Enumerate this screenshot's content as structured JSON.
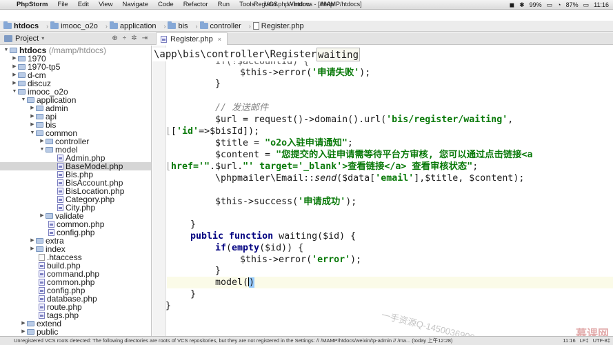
{
  "menubar": {
    "app": "PhpStorm",
    "items": [
      "File",
      "Edit",
      "View",
      "Navigate",
      "Code",
      "Refactor",
      "Run",
      "Tools",
      "VCS",
      "Window",
      "Help"
    ],
    "window_title": "Register.php - htdocs - [/MAMP/htdocs]",
    "tray": {
      "battery_a": "99%",
      "battery_b": "87%",
      "clock": "11:16"
    }
  },
  "breadcrumbs": [
    "htdocs",
    "imooc_o2o",
    "application",
    "bis",
    "controller",
    "Register.php"
  ],
  "project_panel": {
    "title": "Project",
    "root_label": "htdocs",
    "root_path": "(/mamp/htdocs)",
    "items": [
      "1970",
      "1970-tp5",
      "d-cm",
      "discuz",
      "imooc_o2o",
      "application",
      "admin",
      "api",
      "bis",
      "common",
      "controller",
      "model",
      "Admin.php",
      "BaseModel.php",
      "Bis.php",
      "BisAccount.php",
      "BisLocation.php",
      "Category.php",
      "City.php",
      "validate",
      "common.php",
      "config.php",
      "extra",
      "index",
      ".htaccess",
      "build.php",
      "command.php",
      "common.php",
      "config.php",
      "database.php",
      "route.php",
      "tags.php",
      "extend",
      "public"
    ]
  },
  "editor": {
    "tab_label": "Register.php",
    "namespace_bar": "\\app\\bis\\controller\\Register",
    "namespace_method": "waiting",
    "lines": {
      "l0": "if(!$accountId) {",
      "l1a": "$this->error(",
      "l1b": "'申请失败'",
      "l1c": ");",
      "l2": "}",
      "l3": "// 发送邮件",
      "l4a": "$url = request()->domain().url(",
      "l4b": "'bis/register/waiting'",
      "l4c": ",",
      "l5a": "[",
      "l5b": "'id'",
      "l5c": "=>$bisId]);",
      "l6a": "$title = ",
      "l6b": "\"o2o入驻申请通知\"",
      "l6c": ";",
      "l7a": "$content = ",
      "l7b": "\"您提交的入驻申请需等待平台方审核, 您可以通过点击链接<a",
      "l8a": "href='\"",
      "l8b": ".$url.",
      "l8c": "\"' target='_blank'>查看链接</a> 查看审核状态\"",
      "l8d": ";",
      "l9a": "\\phpmailer\\Email::",
      "l9b": "send",
      "l9c": "($data[",
      "l9d": "'email'",
      "l9e": "],$title, $content);",
      "l10a": "$this->success(",
      "l10b": "'申请成功'",
      "l10c": ");",
      "l11": "}",
      "l12a": "public function",
      "l12b": " waiting($id) {",
      "l13a": "if",
      "l13b": "(",
      "l13c": "empty",
      "l13d": "($id)) {",
      "l14a": "$this->error(",
      "l14b": "'error'",
      "l14c": ");",
      "l15": "}",
      "l16a": "model(",
      "l16b": ")",
      "l17": "}",
      "l18": "}"
    }
  },
  "watermark": "一手资源Q-1450036900",
  "brand": "慕课网",
  "statusbar": {
    "message": "Unregistered VCS roots detected: The following directories are roots of VCS repositories, but they are not registered in the Settings: // /MAMP/htdocs/weixin/tp-admin // /ma... (today 上午12:28)",
    "position": "11:16",
    "line_sep": "LF‡",
    "encoding": "UTF-8‡"
  }
}
